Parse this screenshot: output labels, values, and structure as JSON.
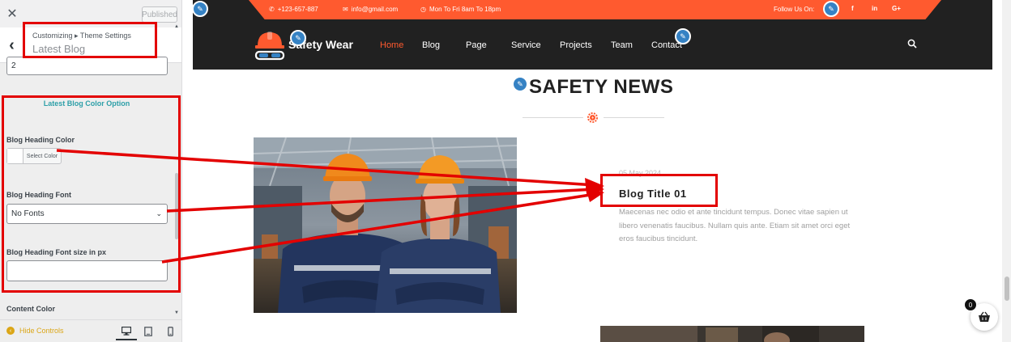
{
  "customizer": {
    "close_icon": "close-icon",
    "publish_label": "Published",
    "breadcrumb": "Customizing ▸ Theme Settings",
    "section_title": "Latest Blog",
    "number_input_value": "2",
    "color_option_title": "Latest Blog Color Option",
    "heading_color_label": "Blog Heading Color",
    "select_color_label": "Select Color",
    "heading_font_label": "Blog Heading Font",
    "heading_font_value": "No Fonts",
    "font_size_label": "Blog Heading Font size in px",
    "font_size_value": "",
    "content_color_label": "Content Color",
    "hide_controls_label": "Hide Controls",
    "devices": [
      "desktop",
      "tablet",
      "mobile"
    ]
  },
  "site": {
    "topbar": {
      "phone": "+123-657-887",
      "email": "info@gmail.com",
      "hours": "Mon To Fri 8am To 18pm",
      "follow_label": "Follow Us On:",
      "social": [
        "f",
        "in",
        "G+"
      ]
    },
    "logo_text": "Safety Wear",
    "nav": [
      "Home",
      "Blog",
      "Page",
      "Service",
      "Projects",
      "Team",
      "Contact"
    ],
    "active_nav": "Home",
    "section_heading": "SAFETY NEWS",
    "blog": {
      "date": "05 May 2024",
      "title": "Blog Title 01",
      "excerpt": "Maecenas nec odio et ante tincidunt tempus. Donec vitae sapien ut libero venenatis faucibus. Nullam quis ante. Etiam sit amet orci eget eros faucibus tincidunt."
    },
    "cart_count": "0"
  },
  "colors": {
    "accent": "#ff5a2f",
    "dark": "#212121",
    "annotation": "#e30000",
    "customizer_accent": "#2d9fa8"
  }
}
